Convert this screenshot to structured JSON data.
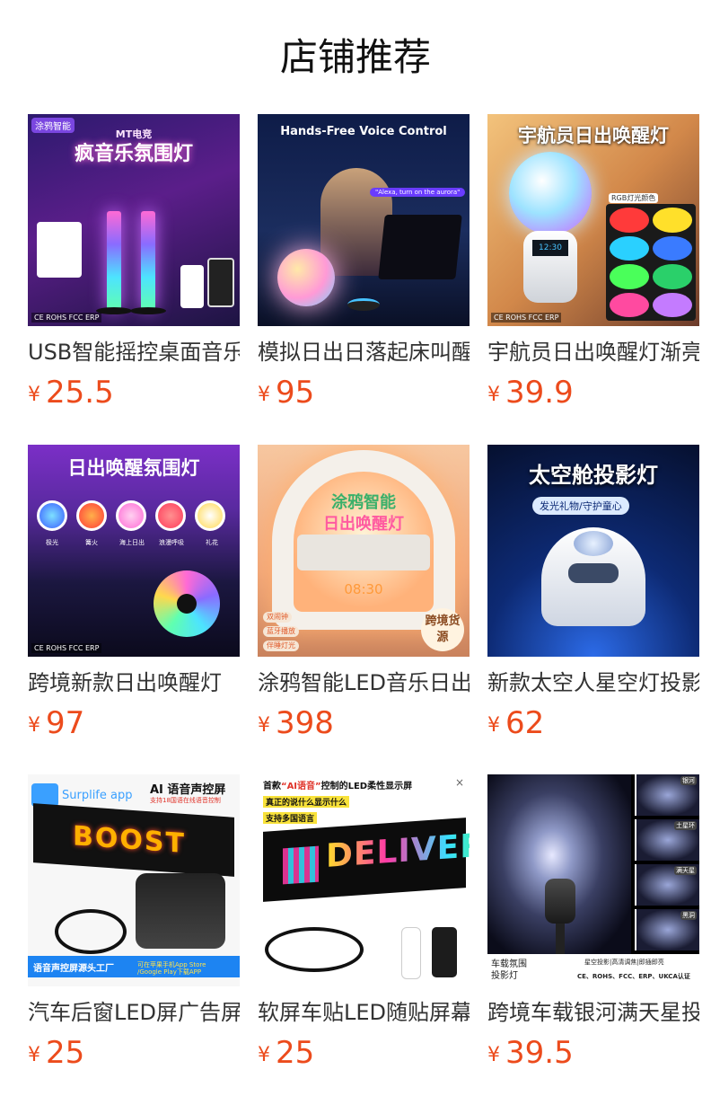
{
  "section_title": "店铺推荐",
  "colors": {
    "price": "#ec4b1c",
    "title": "#111111",
    "name": "#333333"
  },
  "products": [
    {
      "name": "USB智能摇控桌面音乐",
      "currency": "¥",
      "price": "25.5",
      "image_text": {
        "tag": "涂鸦智能",
        "banner_top": "MT电竞",
        "banner": "疯音乐氛围灯",
        "cert": "CE ROHS FCC ERP"
      }
    },
    {
      "name": "模拟日出日落起床叫醒",
      "currency": "¥",
      "price": "95",
      "image_text": {
        "banner": "Hands-Free Voice Control",
        "bubble": "\"Alexa, turn on the aurora\""
      }
    },
    {
      "name": "宇航员日出唤醒灯渐亮",
      "currency": "¥",
      "price": "39.9",
      "image_text": {
        "banner": "宇航员日出唤醒灯",
        "label": "RGB灯光颜色",
        "cert": "CE ROHS FCC ERP"
      }
    },
    {
      "name": "跨境新款日出唤醒灯",
      "currency": "¥",
      "price": "97",
      "image_text": {
        "banner": "日出唤醒氛围灯",
        "modes": [
          "极光",
          "篝火",
          "海上日出",
          "浪漫呼吸",
          "礼花"
        ],
        "cert": "CE ROHS FCC ERP"
      }
    },
    {
      "name": "涂鸦智能LED音乐日出",
      "currency": "¥",
      "price": "398",
      "image_text": {
        "banner": "涂鸦智能",
        "banner2": "日出唤醒灯",
        "features": [
          "双闹钟",
          "蓝牙播放",
          "伴睡灯光"
        ],
        "badge": "跨境货源",
        "clock": "08:30"
      }
    },
    {
      "name": "新款太空人星空灯投影",
      "currency": "¥",
      "price": "62",
      "image_text": {
        "banner": "太空舱投影灯",
        "sub": "发光礼物/守护童心"
      }
    },
    {
      "name": "汽车后窗LED屏广告屏",
      "currency": "¥",
      "price": "25",
      "image_text": {
        "app": "Surplife app",
        "headline": "AI 语音声控屏",
        "sub": "支持18国语在线语音控制",
        "panel": "BOOST",
        "foot_left": "语音声控屏源头工厂",
        "foot_right": "可在苹果手机App Store\n/Google Play下载APP"
      }
    },
    {
      "name": "软屏车贴LED随贴屏幕",
      "currency": "¥",
      "price": "25",
      "image_text": {
        "headline_pre": "首款",
        "headline_mark": "“AI语音”",
        "headline_post": "控制的LED柔性显示屏",
        "line2": "真正的说什么显示什么",
        "line3": "支持多国语言",
        "panel": "DELIVERY"
      }
    },
    {
      "name": "跨境车载银河满天星投影",
      "currency": "¥",
      "price": "39.5",
      "image_text": {
        "tiles": [
          "银河",
          "土星环",
          "满天星",
          "黑洞"
        ],
        "foot_left": "车载氛围\n投影灯",
        "foot_right1": "星空投影|高清调焦|即插即亮",
        "foot_right2": "CE、ROHS、FCC、ERP、UKCA认证"
      }
    }
  ]
}
